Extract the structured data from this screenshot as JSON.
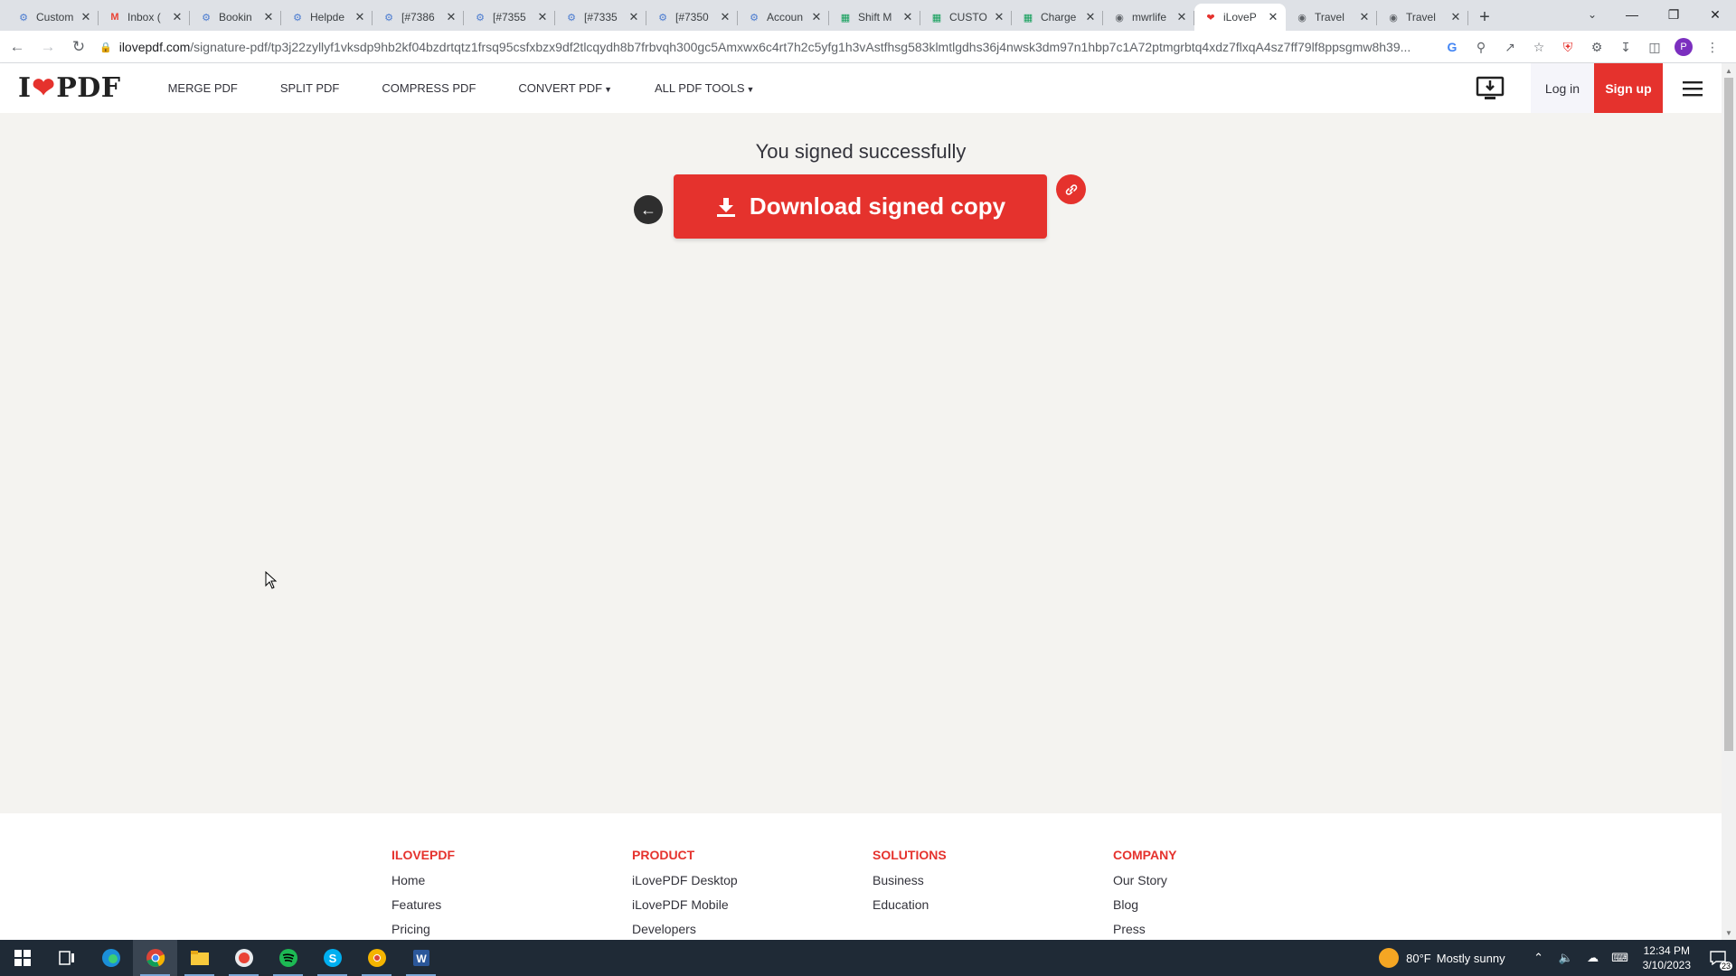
{
  "browser": {
    "tabs": [
      {
        "title": "Custom",
        "icon": "gear-icon",
        "color": "#4a7bd0"
      },
      {
        "title": "Inbox (",
        "icon": "gmail-icon",
        "color": "#ea4335"
      },
      {
        "title": "Bookin",
        "icon": "gear-icon",
        "color": "#4a7bd0"
      },
      {
        "title": "Helpde",
        "icon": "gear-icon",
        "color": "#4a7bd0"
      },
      {
        "title": "[#7386",
        "icon": "gear-icon",
        "color": "#4a7bd0"
      },
      {
        "title": "[#7355",
        "icon": "gear-icon",
        "color": "#4a7bd0"
      },
      {
        "title": "[#7335",
        "icon": "gear-icon",
        "color": "#4a7bd0"
      },
      {
        "title": "[#7350",
        "icon": "gear-icon",
        "color": "#4a7bd0"
      },
      {
        "title": "Accoun",
        "icon": "gear-icon",
        "color": "#4a7bd0"
      },
      {
        "title": "Shift M",
        "icon": "sheets-icon",
        "color": "#0f9d58"
      },
      {
        "title": "CUSTO",
        "icon": "sheets-icon",
        "color": "#0f9d58"
      },
      {
        "title": "Charge",
        "icon": "sheets-icon",
        "color": "#0f9d58"
      },
      {
        "title": "mwrlife",
        "icon": "globe-icon",
        "color": "#5f6368"
      },
      {
        "title": "iLoveP",
        "icon": "heart-icon",
        "color": "#e5322d",
        "active": true
      },
      {
        "title": "Travel",
        "icon": "globe-icon",
        "color": "#5f6368"
      },
      {
        "title": "Travel",
        "icon": "globe-icon",
        "color": "#5f6368"
      }
    ],
    "url_host": "ilovepdf.com",
    "url_path": "/signature-pdf/tp3j22zyllyf1vksdp9hb2kf04bzdrtqtz1frsq95csfxbzx9df2tlcqydh8b7frbvqh300gc5Amxwx6c4rt7h2c5yfg1h3vAstfhsg583klmtlgdhs36j4nwsk3dm97n1hbp7c1A72ptmgrbtq4xdz7flxqA4sz7ff79lf8ppsgmw8h39...",
    "profile_initial": "P"
  },
  "site": {
    "logo_left": "I",
    "logo_right": "PDF",
    "brand_color": "#e5322d",
    "nav": [
      {
        "label": "MERGE PDF",
        "dropdown": false
      },
      {
        "label": "SPLIT PDF",
        "dropdown": false
      },
      {
        "label": "COMPRESS PDF",
        "dropdown": false
      },
      {
        "label": "CONVERT PDF",
        "dropdown": true
      },
      {
        "label": "ALL PDF TOOLS",
        "dropdown": true
      }
    ],
    "login_label": "Log in",
    "signup_label": "Sign up"
  },
  "main": {
    "title": "You signed successfully",
    "download_label": "Download signed copy"
  },
  "footer": {
    "columns": [
      {
        "heading": "ILOVEPDF",
        "links": [
          "Home",
          "Features",
          "Pricing"
        ]
      },
      {
        "heading": "PRODUCT",
        "links": [
          "iLovePDF Desktop",
          "iLovePDF Mobile",
          "Developers"
        ]
      },
      {
        "heading": "SOLUTIONS",
        "links": [
          "Business",
          "Education"
        ]
      },
      {
        "heading": "COMPANY",
        "links": [
          "Our Story",
          "Blog",
          "Press"
        ]
      }
    ]
  },
  "taskbar": {
    "weather_temp": "80°F",
    "weather_desc": "Mostly sunny",
    "time": "12:34 PM",
    "date": "3/10/2023",
    "notification_count": "23"
  }
}
